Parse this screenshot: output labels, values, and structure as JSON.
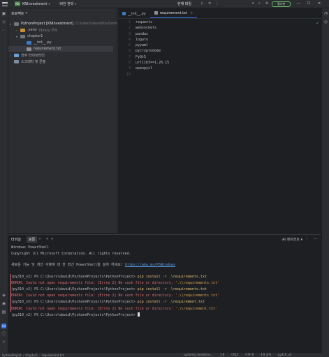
{
  "titlebar": {
    "project_badge": "KN",
    "project_name": "KNInvestment",
    "branch": "버전 관리",
    "run_config": "현재 파일",
    "upgrade_label": "평가판"
  },
  "project_panel": {
    "title": "프로젝트",
    "tree": [
      {
        "label": "PythonProject [KNInvestment]",
        "hint": "C:\\Users\\david\\PycharmProjects\\"
      },
      {
        "label": ".venv",
        "hint": "library 루트"
      },
      {
        "label": "chapter1",
        "hint": ""
      },
      {
        "label": "__init__.py",
        "hint": ""
      },
      {
        "label": "requirement.txt",
        "hint": ""
      },
      {
        "label": "외부 라이브러리",
        "hint": ""
      },
      {
        "label": "스크래치 및 콘솔",
        "hint": ""
      }
    ]
  },
  "editor": {
    "tabs": [
      {
        "label": "__init__.py"
      },
      {
        "label": "requirement.txt"
      }
    ],
    "line_numbers": [
      "1",
      "2",
      "3",
      "4",
      "5",
      "6",
      "7",
      "8",
      "9",
      "10"
    ],
    "lines": [
      "requests",
      "websockets",
      "pandas",
      "loguru",
      "pyyaml",
      "pycryptodome",
      "PyQt5",
      "urllib3==1.26.15",
      "openpyxl",
      ""
    ]
  },
  "terminal": {
    "title": "터미널",
    "tab_label": "로컬",
    "ai_label": "AI 에이전트",
    "lines": [
      {
        "kind": "out",
        "text": "Windows PowerShell"
      },
      {
        "kind": "out",
        "text": "Copyright (C) Microsoft Corporation. All rights reserved."
      },
      {
        "kind": "blank",
        "text": ""
      },
      {
        "kind": "out",
        "text": "새로운 기능 및 개선 사항에 대 한 최신 PowerShell을 설치 하세요! ",
        "link": "https://aka.ms/PSWindows"
      },
      {
        "kind": "blank",
        "text": ""
      },
      {
        "kind": "prompt",
        "text": "(py310_v2) PS C:\\Users\\david\\PycharmProjects\\PythonProject> ",
        "cmd": "pip install -r .\\requirements.txt"
      },
      {
        "kind": "err",
        "text": "ERROR: Could not open requirements file: [Errno 2] No such file or directory: ",
        "path": "'.\\\\requirements.txt'"
      },
      {
        "kind": "prompt",
        "text": "(py310_v2) PS C:\\Users\\david\\PycharmProjects\\PythonProject> ",
        "cmd": "pip install -r .\\requirements.txt"
      },
      {
        "kind": "err",
        "text": "ERROR: Could not open requirements file: [Errno 2] No such file or directory: ",
        "path": "'.\\\\requirements.txt'"
      },
      {
        "kind": "prompt",
        "text": "(py310_v2) PS C:\\Users\\david\\PycharmProjects\\PythonProject> ",
        "cmd": "pip install -r .\\requirement.txt"
      },
      {
        "kind": "err",
        "text": "ERROR: Could not open requirements file: [Errno 2] No such file or directory: ",
        "path": "'.\\\\requirement.txt'"
      },
      {
        "kind": "prompt",
        "text": "(py310_v2) PS C:\\Users\\david\\PycharmProjects\\PythonProject> ",
        "cmd": ""
      }
    ]
  },
  "statusbar": {
    "breadcrumbs": [
      "PythonProject",
      "chapter1",
      "requirement.txt"
    ],
    "right_items": [
      "updating skeletons...",
      "1:8",
      "CRLF",
      "UTF-8",
      "4개 공백",
      "py310_v2"
    ]
  },
  "colors": {
    "accent": "#3574f0",
    "error": "#e06c75",
    "command": "#e5c07b",
    "upgrade_border": "#5fb865"
  }
}
